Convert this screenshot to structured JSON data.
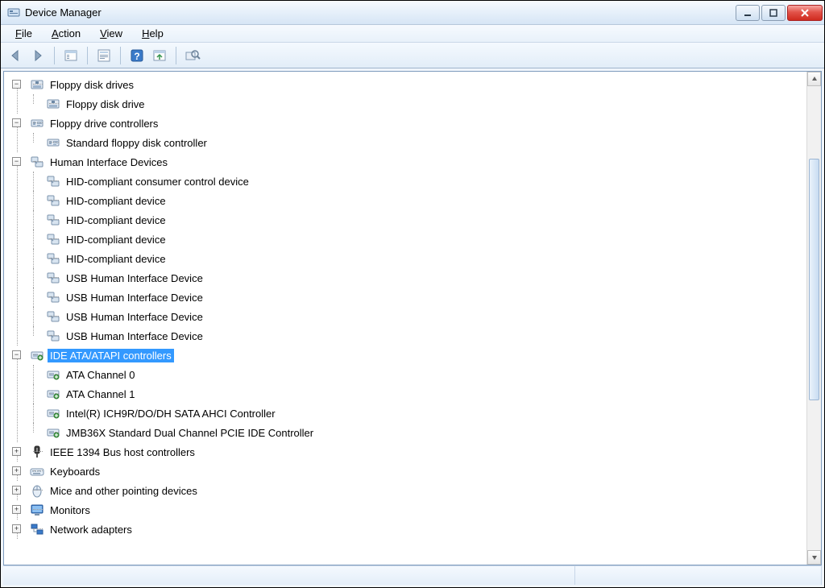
{
  "window": {
    "title": "Device Manager"
  },
  "menu": {
    "file": "File",
    "action": "Action",
    "view": "View",
    "help": "Help"
  },
  "tree": [
    {
      "label": "Floppy disk drives",
      "icon": "floppy-drive",
      "expanded": true,
      "children": [
        {
          "label": "Floppy disk drive",
          "icon": "floppy-drive"
        }
      ]
    },
    {
      "label": "Floppy drive controllers",
      "icon": "floppy-controller",
      "expanded": true,
      "children": [
        {
          "label": "Standard floppy disk controller",
          "icon": "floppy-controller"
        }
      ]
    },
    {
      "label": "Human Interface Devices",
      "icon": "hid",
      "expanded": true,
      "children": [
        {
          "label": "HID-compliant consumer control device",
          "icon": "hid"
        },
        {
          "label": "HID-compliant device",
          "icon": "hid"
        },
        {
          "label": "HID-compliant device",
          "icon": "hid"
        },
        {
          "label": "HID-compliant device",
          "icon": "hid"
        },
        {
          "label": "HID-compliant device",
          "icon": "hid"
        },
        {
          "label": "USB Human Interface Device",
          "icon": "hid"
        },
        {
          "label": "USB Human Interface Device",
          "icon": "hid"
        },
        {
          "label": "USB Human Interface Device",
          "icon": "hid"
        },
        {
          "label": "USB Human Interface Device",
          "icon": "hid"
        }
      ]
    },
    {
      "label": "IDE ATA/ATAPI controllers",
      "icon": "ide",
      "expanded": true,
      "selected": true,
      "children": [
        {
          "label": "ATA Channel 0",
          "icon": "ide"
        },
        {
          "label": "ATA Channel 1",
          "icon": "ide"
        },
        {
          "label": "Intel(R) ICH9R/DO/DH SATA AHCI Controller",
          "icon": "ide"
        },
        {
          "label": "JMB36X Standard Dual Channel PCIE IDE Controller",
          "icon": "ide"
        }
      ]
    },
    {
      "label": "IEEE 1394 Bus host controllers",
      "icon": "ieee1394",
      "expanded": false
    },
    {
      "label": "Keyboards",
      "icon": "keyboard",
      "expanded": false
    },
    {
      "label": "Mice and other pointing devices",
      "icon": "mouse",
      "expanded": false
    },
    {
      "label": "Monitors",
      "icon": "monitor",
      "expanded": false
    },
    {
      "label": "Network adapters",
      "icon": "network",
      "expanded": false
    }
  ]
}
